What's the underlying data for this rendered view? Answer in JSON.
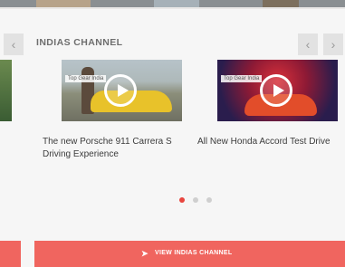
{
  "section": {
    "title": "INDIAS CHANNEL"
  },
  "navigation": {
    "prev_icon": "chevron-left-icon",
    "next_icon": "chevron-right-icon"
  },
  "videos": [
    {
      "badge": "Top Gear India",
      "title": "The new Porsche 911 Carrera S Driving Experience",
      "icon": "play-icon"
    },
    {
      "badge": "Top Gear India",
      "title": "All New Honda Accord Test Drive",
      "icon": "play-icon"
    }
  ],
  "pagination": {
    "total": 3,
    "active": 0
  },
  "cta": {
    "label": "VIEW INDIAS CHANNEL",
    "icon": "play-arrow-icon"
  },
  "colors": {
    "accent": "#f0655f",
    "dot_active": "#e8453e"
  }
}
